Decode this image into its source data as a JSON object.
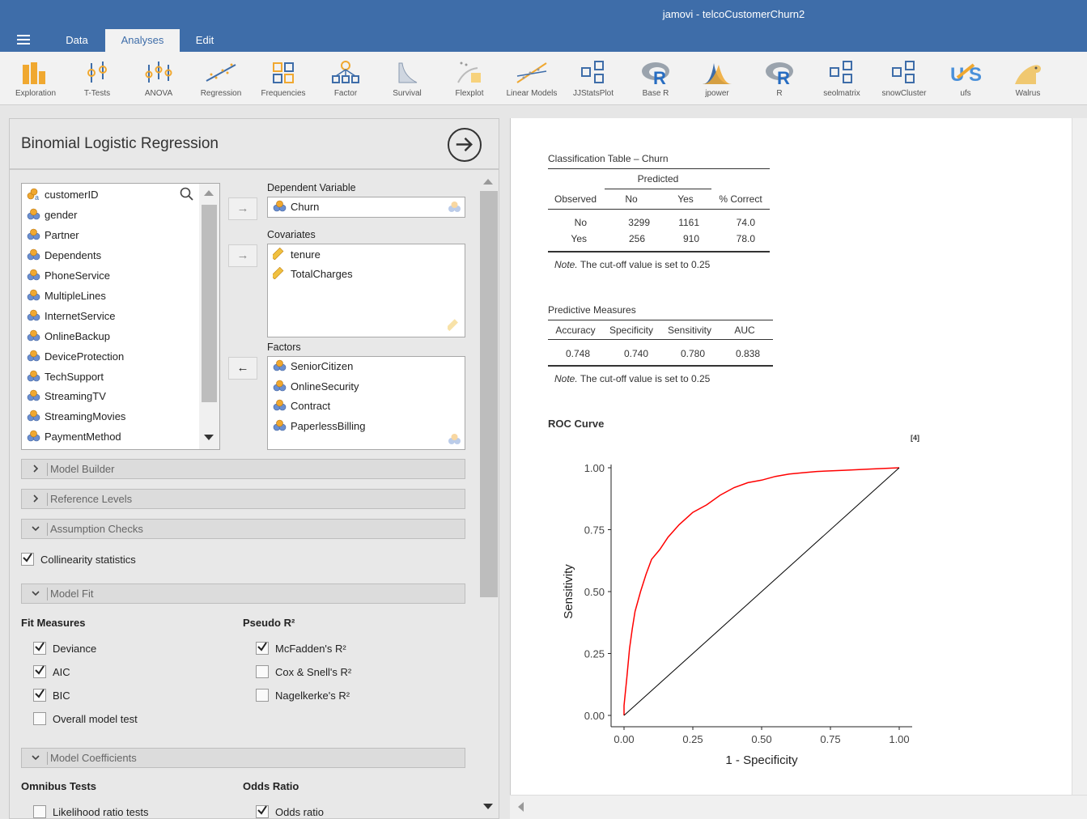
{
  "app": {
    "window_title": "jamovi - telcoCustomerChurn2",
    "menu_tabs": [
      "Data",
      "Analyses",
      "Edit"
    ],
    "active_tab": "Analyses"
  },
  "ribbon": [
    {
      "label": "Exploration",
      "icon": "exploration-icon"
    },
    {
      "label": "T-Tests",
      "icon": "t-tests-icon"
    },
    {
      "label": "ANOVA",
      "icon": "anova-icon"
    },
    {
      "label": "Regression",
      "icon": "regression-icon"
    },
    {
      "label": "Frequencies",
      "icon": "frequencies-icon"
    },
    {
      "label": "Factor",
      "icon": "factor-icon"
    },
    {
      "label": "Survival",
      "icon": "survival-icon"
    },
    {
      "label": "Flexplot",
      "icon": "flexplot-icon"
    },
    {
      "label": "Linear Models",
      "icon": "linear-models-icon"
    },
    {
      "label": "JJStatsPlot",
      "icon": "jjstatsplot-icon"
    },
    {
      "label": "Base R",
      "icon": "base-r-icon"
    },
    {
      "label": "jpower",
      "icon": "jpower-icon"
    },
    {
      "label": "R",
      "icon": "r-icon"
    },
    {
      "label": "seolmatrix",
      "icon": "seolmatrix-icon"
    },
    {
      "label": "snowCluster",
      "icon": "snowcluster-icon"
    },
    {
      "label": "ufs",
      "icon": "ufs-icon"
    },
    {
      "label": "Walrus",
      "icon": "walrus-icon"
    }
  ],
  "options": {
    "title": "Binomial Logistic Regression",
    "variables": [
      "customerID",
      "gender",
      "Partner",
      "Dependents",
      "PhoneService",
      "MultipleLines",
      "InternetService",
      "OnlineBackup",
      "DeviceProtection",
      "TechSupport",
      "StreamingTV",
      "StreamingMovies",
      "PaymentMethod"
    ],
    "dependent_label": "Dependent Variable",
    "dependent": "Churn",
    "covariates_label": "Covariates",
    "covariates": [
      "tenure",
      "TotalCharges"
    ],
    "factors_label": "Factors",
    "factors": [
      "SeniorCitizen",
      "OnlineSecurity",
      "Contract",
      "PaperlessBilling"
    ],
    "sections": {
      "model_builder": "Model Builder",
      "reference_levels": "Reference Levels",
      "assumption_checks": "Assumption Checks",
      "model_fit": "Model Fit",
      "model_coefficients": "Model Coefficients"
    },
    "collinearity": {
      "label": "Collinearity statistics",
      "checked": true
    },
    "fit_measures_label": "Fit Measures",
    "fit_measures": [
      {
        "label": "Deviance",
        "checked": true
      },
      {
        "label": "AIC",
        "checked": true
      },
      {
        "label": "BIC",
        "checked": true
      },
      {
        "label": "Overall model test",
        "checked": false
      }
    ],
    "pseudo_r2_label": "Pseudo R²",
    "pseudo_r2": [
      {
        "label": "McFadden's R²",
        "checked": true
      },
      {
        "label": "Cox & Snell's R²",
        "checked": false
      },
      {
        "label": "Nagelkerke's R²",
        "checked": false
      }
    ],
    "omnibus_label": "Omnibus Tests",
    "omnibus": [
      {
        "label": "Likelihood ratio tests",
        "checked": false
      }
    ],
    "odds_ratio_label": "Odds Ratio",
    "odds_ratio": [
      {
        "label": "Odds ratio",
        "checked": true
      }
    ]
  },
  "results": {
    "classification": {
      "title": "Classification Table – Churn",
      "predicted_label": "Predicted",
      "headers": [
        "Observed",
        "No",
        "Yes",
        "% Correct"
      ],
      "rows": [
        [
          "No",
          "3299",
          "1161",
          "74.0"
        ],
        [
          "Yes",
          "256",
          "910",
          "78.0"
        ]
      ],
      "note_label": "Note.",
      "note": "The cut-off value is set to 0.25"
    },
    "predictive": {
      "title": "Predictive Measures",
      "headers": [
        "Accuracy",
        "Specificity",
        "Sensitivity",
        "AUC"
      ],
      "row": [
        "0.748",
        "0.740",
        "0.780",
        "0.838"
      ],
      "note_label": "Note.",
      "note": "The cut-off value is set to 0.25"
    },
    "roc": {
      "title": "ROC Curve",
      "ref": "[4]"
    }
  },
  "chart_data": {
    "type": "line",
    "title": "ROC Curve",
    "xlabel": "1 - Specificity",
    "ylabel": "Sensitivity",
    "xlim": [
      0,
      1
    ],
    "ylim": [
      0,
      1
    ],
    "xticks": [
      "0.00",
      "0.25",
      "0.50",
      "0.75",
      "1.00"
    ],
    "yticks": [
      "0.00",
      "0.25",
      "0.50",
      "0.75",
      "1.00"
    ],
    "series": [
      {
        "color": "#ff0000",
        "x": [
          0.0,
          0.0,
          0.01,
          0.02,
          0.03,
          0.04,
          0.06,
          0.08,
          0.1,
          0.13,
          0.16,
          0.2,
          0.25,
          0.3,
          0.35,
          0.4,
          0.45,
          0.5,
          0.55,
          0.6,
          0.65,
          0.7,
          0.8,
          0.9,
          1.0
        ],
        "y": [
          0.0,
          0.04,
          0.15,
          0.27,
          0.35,
          0.42,
          0.5,
          0.57,
          0.63,
          0.67,
          0.72,
          0.77,
          0.82,
          0.85,
          0.89,
          0.92,
          0.94,
          0.95,
          0.965,
          0.975,
          0.98,
          0.985,
          0.99,
          0.995,
          1.0
        ]
      },
      {
        "color": "#000000",
        "x": [
          0,
          1
        ],
        "y": [
          0,
          1
        ]
      }
    ],
    "grid": false
  }
}
